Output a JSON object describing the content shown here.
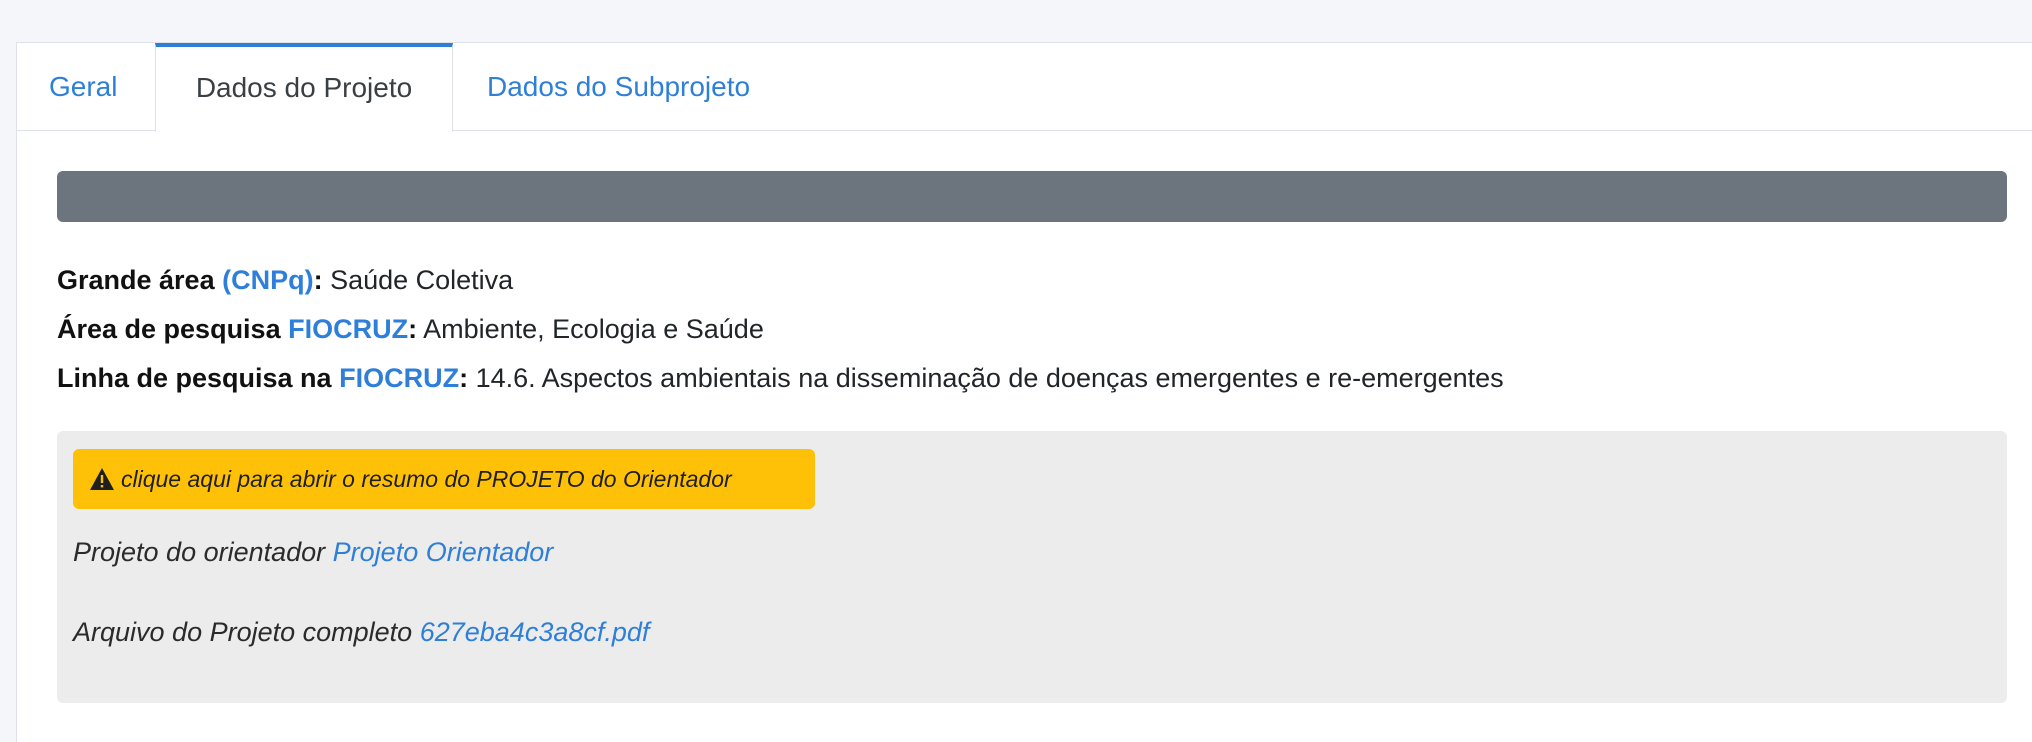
{
  "tabs": [
    {
      "label": "Geral"
    },
    {
      "label": "Dados do Projeto"
    },
    {
      "label": "Dados do Subprojeto"
    }
  ],
  "info": {
    "grande_area": {
      "prefix": "Grande área ",
      "highlight": "(CNPq)",
      "suffix": ":",
      "value": " Saúde Coletiva"
    },
    "area_pesquisa": {
      "prefix": "Área de pesquisa ",
      "highlight": "FIOCRUZ",
      "suffix": ":",
      "value": " Ambiente, Ecologia e Saúde"
    },
    "linha_pesquisa": {
      "prefix": "Linha de pesquisa na ",
      "highlight": "FIOCRUZ",
      "suffix": ":",
      "value": " 14.6. Aspectos ambientais na disseminação de doenças emergentes e re-emergentes"
    }
  },
  "panel": {
    "warning_button": "clique aqui para abrir o resumo do PROJETO do Orientador",
    "projeto_label": "Projeto do orientador ",
    "projeto_link": "Projeto Orientador",
    "arquivo_label": "Arquivo do Projeto completo ",
    "arquivo_link": "627eba4c3a8cf.pdf"
  },
  "colors": {
    "accent": "#2e7fd9",
    "warning": "#ffc107",
    "bar": "#6c757d",
    "panel_bg": "#ececec"
  }
}
